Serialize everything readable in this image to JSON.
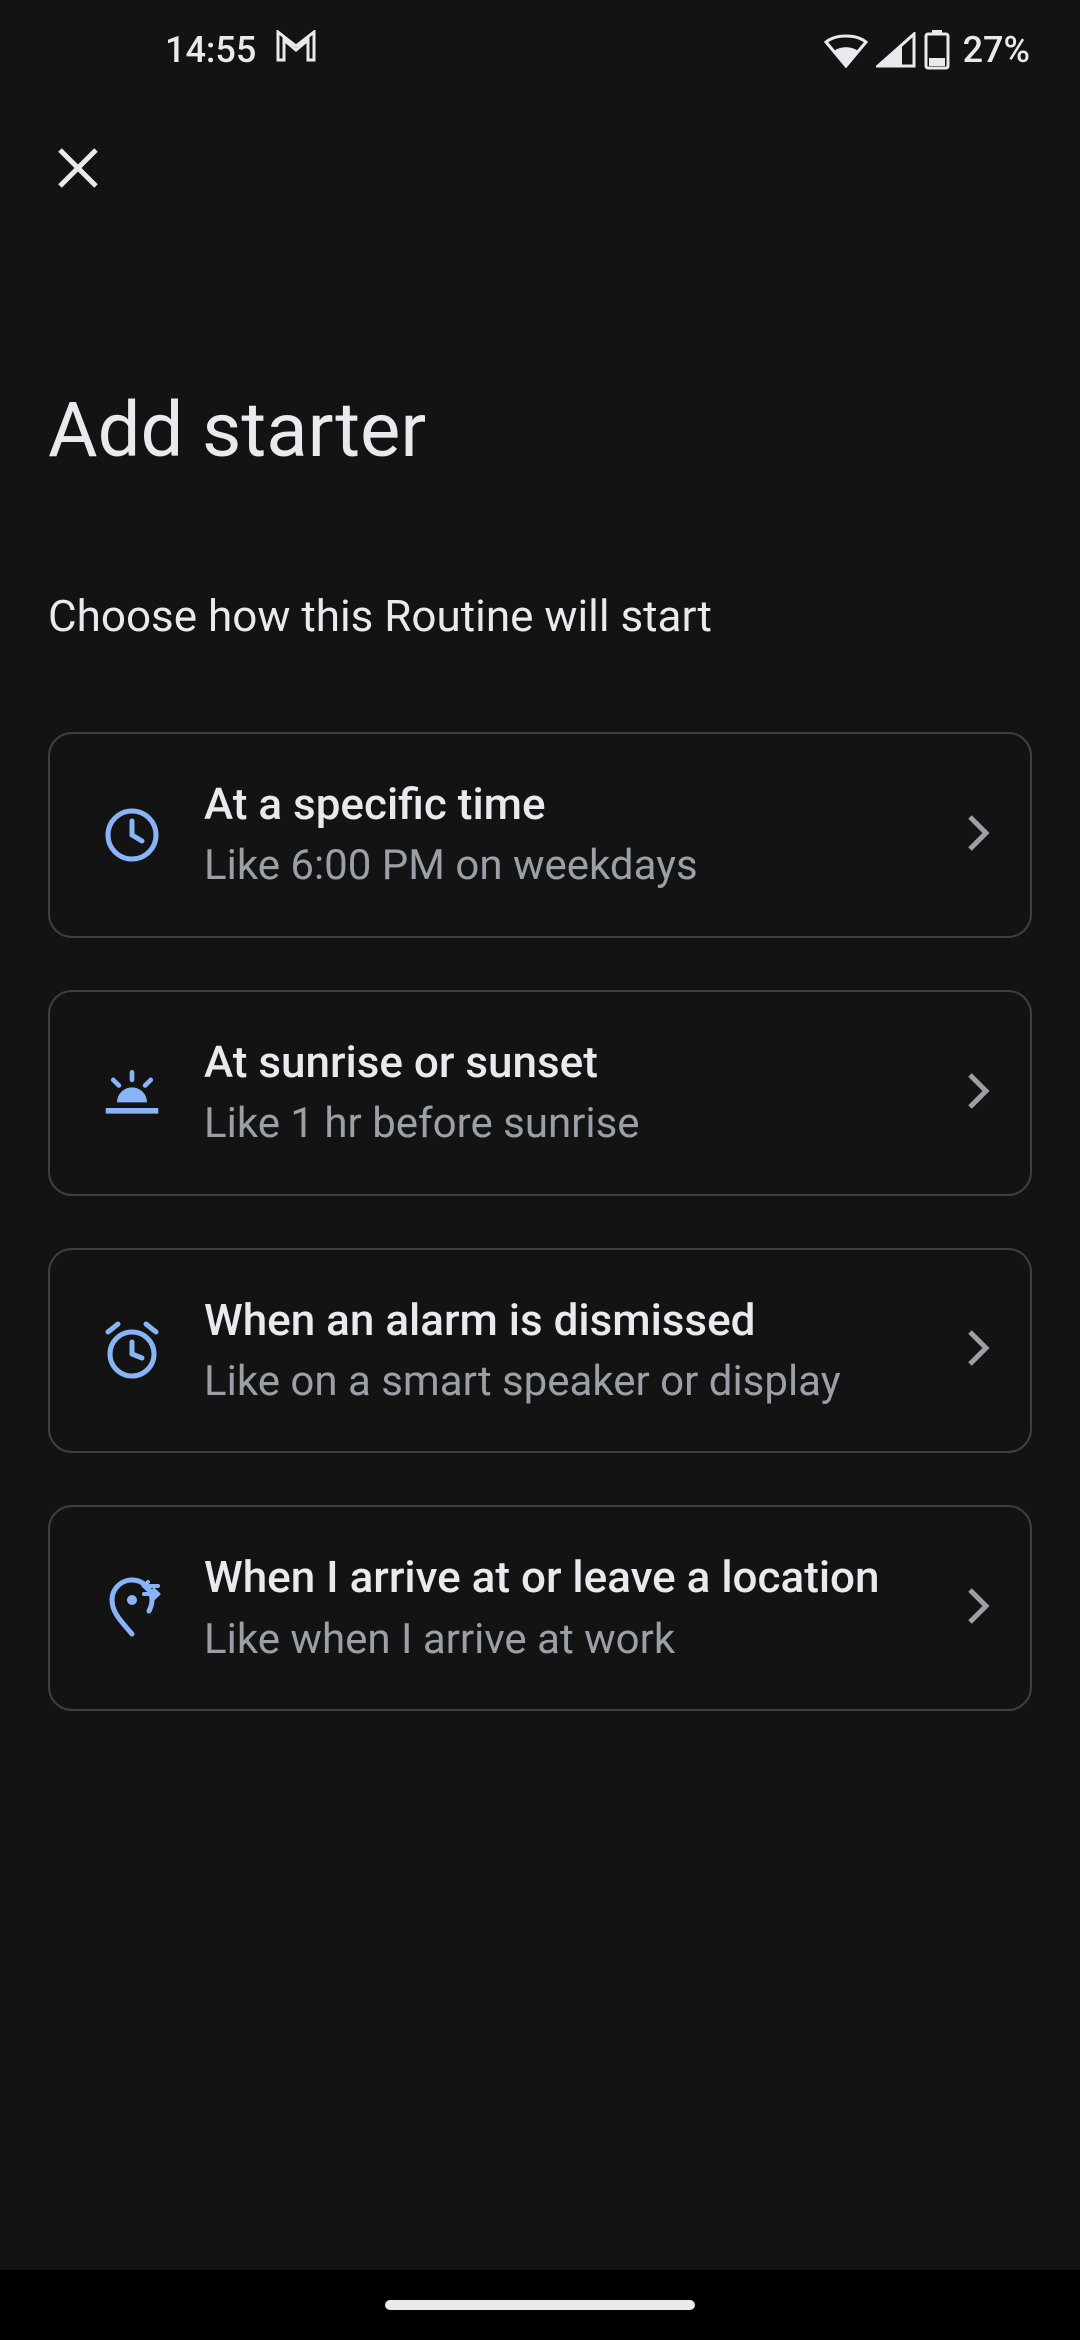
{
  "status": {
    "time": "14:55",
    "battery": "27%"
  },
  "page": {
    "title": "Add starter",
    "subtitle": "Choose how this Routine will start"
  },
  "options": [
    {
      "icon": "clock-icon",
      "title": "At a specific time",
      "desc": "Like 6:00 PM on weekdays"
    },
    {
      "icon": "sunrise-icon",
      "title": "At sunrise or sunset",
      "desc": "Like 1 hr before sunrise"
    },
    {
      "icon": "alarm-icon",
      "title": "When an alarm is dismissed",
      "desc": "Like on a smart speaker or display"
    },
    {
      "icon": "location-icon",
      "title": "When I arrive at or leave a location",
      "desc": "Like when I arrive at work"
    }
  ]
}
